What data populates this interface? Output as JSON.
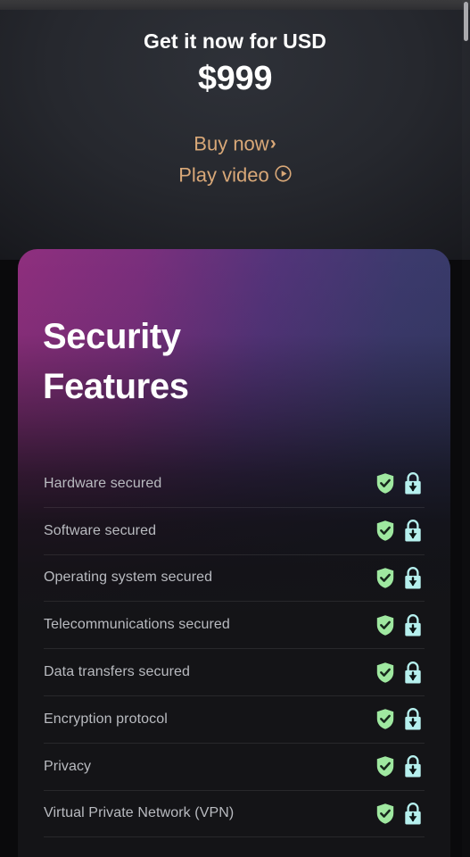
{
  "browser": {
    "scrollbar_visible": true
  },
  "hero": {
    "kicker": "Get it now for USD",
    "price": "$999",
    "buy_link": "Buy now",
    "buy_icon": "chevron-right-icon",
    "video_link": "Play video",
    "video_icon": "play-circle-icon",
    "link_color": "#d9a878",
    "text_color": "#ffffff"
  },
  "card": {
    "title_line1": "Security",
    "title_line2": "Features",
    "gradient_from": "#8f2f7e",
    "gradient_to": "#323a63",
    "body_color": "#141417"
  },
  "features": {
    "shield_icon": "shield-check-icon",
    "lock_icon": "lock-download-icon",
    "shield_color": "#9fe8a0",
    "lock_color": "#b6f0ee",
    "items": [
      {
        "label": "Hardware secured"
      },
      {
        "label": "Software secured"
      },
      {
        "label": "Operating system secured"
      },
      {
        "label": "Telecommunications secured"
      },
      {
        "label": "Data transfers secured"
      },
      {
        "label": "Encryption protocol"
      },
      {
        "label": "Privacy"
      },
      {
        "label": "Virtual Private Network (VPN)"
      }
    ]
  }
}
